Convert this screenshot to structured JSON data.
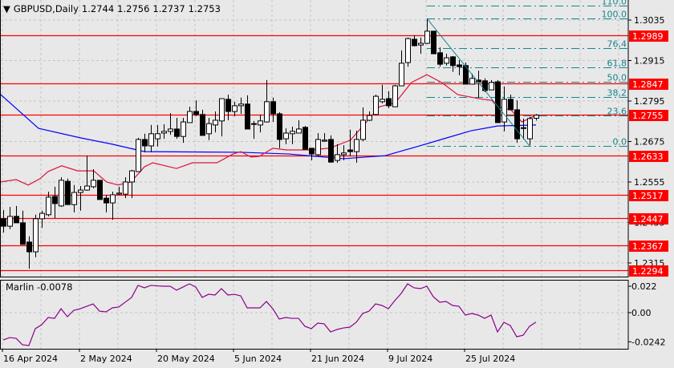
{
  "header": {
    "menu_icon": "triangle-down-icon",
    "symbol_timeframe": "GBPUSD,Daily",
    "open": "1.2744",
    "high": "1.2756",
    "low": "1.2737",
    "close": "1.2753"
  },
  "indicator": {
    "name": "Marlin",
    "value": "-0.0078"
  },
  "colors": {
    "background": "#e8e8e8",
    "level_lines": "#ff0000",
    "fibo": "#17868e",
    "ma_slow": "#0000ff",
    "ma_fast": "#dc143c",
    "marlin": "#8b008b",
    "grid": "#c4c4c4"
  },
  "chart_data": {
    "type": "candlestick",
    "title": "GBPUSD,Daily",
    "x_tick_labels": [
      {
        "bar": 0,
        "label": "16 Apr 2024"
      },
      {
        "bar": 12,
        "label": "2 May 2024"
      },
      {
        "bar": 24,
        "label": "20 May 2024"
      },
      {
        "bar": 36,
        "label": "5 Jun 2024"
      },
      {
        "bar": 48,
        "label": "21 Jun 2024"
      },
      {
        "bar": 60,
        "label": "9 Jul 2024"
      },
      {
        "bar": 72,
        "label": "25 Jul 2024"
      }
    ],
    "y_tick_labels": [
      "1.3035",
      "1.2915",
      "1.2795",
      "1.2675",
      "1.2555",
      "1.2435",
      "1.2315"
    ],
    "ylim": [
      1.2274,
      1.3115
    ],
    "grid": true,
    "candles_ohlc": [
      [
        1.2446,
        1.2472,
        1.2405,
        1.2424
      ],
      [
        1.2424,
        1.2481,
        1.2415,
        1.2453
      ],
      [
        1.2453,
        1.2484,
        1.2434,
        1.2434
      ],
      [
        1.2434,
        1.247,
        1.237,
        1.237
      ],
      [
        1.2377,
        1.2394,
        1.2298,
        1.2348
      ],
      [
        1.2348,
        1.2458,
        1.2332,
        1.2446
      ],
      [
        1.2446,
        1.247,
        1.2419,
        1.2462
      ],
      [
        1.2458,
        1.2526,
        1.2453,
        1.251
      ],
      [
        1.2512,
        1.2541,
        1.2448,
        1.2491
      ],
      [
        1.2484,
        1.2569,
        1.2481,
        1.256
      ],
      [
        1.2557,
        1.2565,
        1.2488,
        1.2488
      ],
      [
        1.2488,
        1.2546,
        1.2465,
        1.2524
      ],
      [
        1.2524,
        1.2543,
        1.247,
        1.2531
      ],
      [
        1.2531,
        1.2633,
        1.2529,
        1.2543
      ],
      [
        1.2541,
        1.2593,
        1.2536,
        1.256
      ],
      [
        1.256,
        1.256,
        1.2503,
        1.2503
      ],
      [
        1.2507,
        1.2517,
        1.2465,
        1.2493
      ],
      [
        1.2493,
        1.2526,
        1.2443,
        1.2517
      ],
      [
        1.2519,
        1.2541,
        1.2517,
        1.2522
      ],
      [
        1.2519,
        1.2569,
        1.2507,
        1.2555
      ],
      [
        1.2555,
        1.2591,
        1.2507,
        1.2588
      ],
      [
        1.2586,
        1.2686,
        1.2586,
        1.2681
      ],
      [
        1.2681,
        1.2698,
        1.2643,
        1.2662
      ],
      [
        1.2662,
        1.2724,
        1.2643,
        1.2698
      ],
      [
        1.2683,
        1.2724,
        1.266,
        1.2698
      ],
      [
        1.27,
        1.2726,
        1.2683,
        1.2705
      ],
      [
        1.2705,
        1.2759,
        1.2695,
        1.2712
      ],
      [
        1.2712,
        1.2745,
        1.2683,
        1.269
      ],
      [
        1.269,
        1.2745,
        1.2671,
        1.2733
      ],
      [
        1.2731,
        1.2778,
        1.2731,
        1.2764
      ],
      [
        1.2764,
        1.2797,
        1.275,
        1.2755
      ],
      [
        1.2755,
        1.2769,
        1.2693,
        1.2693
      ],
      [
        1.2698,
        1.2745,
        1.2679,
        1.2728
      ],
      [
        1.2724,
        1.2764,
        1.2702,
        1.2738
      ],
      [
        1.2736,
        1.2802,
        1.269,
        1.2802
      ],
      [
        1.28,
        1.2814,
        1.2738,
        1.2764
      ],
      [
        1.2764,
        1.2793,
        1.275,
        1.2781
      ],
      [
        1.2781,
        1.2805,
        1.2757,
        1.2786
      ],
      [
        1.2786,
        1.2812,
        1.2712,
        1.2712
      ],
      [
        1.2728,
        1.2736,
        1.2683,
        1.2726
      ],
      [
        1.2724,
        1.2755,
        1.2702,
        1.2736
      ],
      [
        1.2733,
        1.2857,
        1.2731,
        1.2793
      ],
      [
        1.2793,
        1.2805,
        1.2733,
        1.2757
      ],
      [
        1.2757,
        1.2762,
        1.2655,
        1.2681
      ],
      [
        1.2683,
        1.2714,
        1.2667,
        1.27
      ],
      [
        1.2698,
        1.2719,
        1.2667,
        1.2705
      ],
      [
        1.27,
        1.2738,
        1.27,
        1.2712
      ],
      [
        1.2717,
        1.2721,
        1.2652,
        1.2652
      ],
      [
        1.2655,
        1.2655,
        1.2619,
        1.2638
      ],
      [
        1.2636,
        1.27,
        1.2631,
        1.2681
      ],
      [
        1.2676,
        1.27,
        1.2674,
        1.2679
      ],
      [
        1.2681,
        1.2693,
        1.2612,
        1.2614
      ],
      [
        1.2619,
        1.2667,
        1.2612,
        1.2636
      ],
      [
        1.2636,
        1.2664,
        1.2619,
        1.2641
      ],
      [
        1.265,
        1.271,
        1.2631,
        1.2645
      ],
      [
        1.2645,
        1.2707,
        1.2612,
        1.2681
      ],
      [
        1.2681,
        1.2776,
        1.2676,
        1.2738
      ],
      [
        1.2738,
        1.2764,
        1.2736,
        1.2752
      ],
      [
        1.2755,
        1.2814,
        1.2752,
        1.2809
      ],
      [
        1.2793,
        1.2843,
        1.2788,
        1.28
      ],
      [
        1.2802,
        1.2824,
        1.2774,
        1.2781
      ],
      [
        1.2778,
        1.2843,
        1.2778,
        1.284
      ],
      [
        1.284,
        1.2945,
        1.284,
        1.2907
      ],
      [
        1.2909,
        1.2983,
        1.2897,
        1.298
      ],
      [
        1.2978,
        1.299,
        1.2957,
        1.2959
      ],
      [
        1.2961,
        1.2983,
        1.2935,
        1.2966
      ],
      [
        1.2966,
        1.304,
        1.2964,
        1.3002
      ],
      [
        1.3002,
        1.3002,
        1.2935,
        1.2935
      ],
      [
        1.2938,
        1.2954,
        1.2897,
        1.2904
      ],
      [
        1.2907,
        1.2935,
        1.29,
        1.2923
      ],
      [
        1.2926,
        1.2928,
        1.2881,
        1.29
      ],
      [
        1.2902,
        1.2916,
        1.2871,
        1.2897
      ],
      [
        1.29,
        1.2909,
        1.2845,
        1.2845
      ],
      [
        1.2845,
        1.2876,
        1.2845,
        1.2862
      ],
      [
        1.2857,
        1.2885,
        1.2805,
        1.2852
      ],
      [
        1.2855,
        1.2862,
        1.2821,
        1.2826
      ],
      [
        1.2828,
        1.2857,
        1.2828,
        1.285
      ],
      [
        1.2852,
        1.2857,
        1.2731,
        1.2731
      ],
      [
        1.2733,
        1.2838,
        1.2705,
        1.28
      ],
      [
        1.28,
        1.2814,
        1.2769,
        1.2769
      ],
      [
        1.2769,
        1.2797,
        1.2671,
        1.2683
      ],
      [
        1.2714,
        1.2743,
        1.2681,
        1.2716
      ],
      [
        1.2683,
        1.2748,
        1.2664,
        1.2743
      ],
      [
        1.2744,
        1.2756,
        1.2737,
        1.2753
      ]
    ],
    "ma_slow": [
      [
        -0.5,
        1.2816
      ],
      [
        5.5,
        1.2714
      ],
      [
        12,
        1.2686
      ],
      [
        17,
        1.2667
      ],
      [
        22,
        1.2645
      ],
      [
        37,
        1.2643
      ],
      [
        44.5,
        1.2638
      ],
      [
        53,
        1.2624
      ],
      [
        59.5,
        1.2633
      ],
      [
        64.5,
        1.266
      ],
      [
        68.6,
        1.2683
      ],
      [
        72.9,
        1.2707
      ],
      [
        77,
        1.2721
      ],
      [
        83,
        1.2724
      ]
    ],
    "ma_fast": [
      [
        -0.5,
        1.2555
      ],
      [
        2,
        1.2562
      ],
      [
        3.9,
        1.2546
      ],
      [
        5.75,
        1.2565
      ],
      [
        7,
        1.2586
      ],
      [
        9.1,
        1.2603
      ],
      [
        11.6,
        1.2588
      ],
      [
        14.1,
        1.2588
      ],
      [
        16.1,
        1.2555
      ],
      [
        17.9,
        1.2546
      ],
      [
        19.9,
        1.2555
      ],
      [
        22,
        1.26
      ],
      [
        23.3,
        1.2612
      ],
      [
        27,
        1.2595
      ],
      [
        29.5,
        1.2612
      ],
      [
        33.3,
        1.2612
      ],
      [
        35.8,
        1.2638
      ],
      [
        37,
        1.2645
      ],
      [
        38.6,
        1.2629
      ],
      [
        39.9,
        1.2631
      ],
      [
        42,
        1.2655
      ],
      [
        44.1,
        1.265
      ],
      [
        47.9,
        1.265
      ],
      [
        50.8,
        1.2655
      ],
      [
        54.1,
        1.2679
      ],
      [
        56.6,
        1.2733
      ],
      [
        58.6,
        1.2778
      ],
      [
        61.1,
        1.279
      ],
      [
        63.6,
        1.285
      ],
      [
        66,
        1.2873
      ],
      [
        68.3,
        1.285
      ],
      [
        70.8,
        1.2814
      ],
      [
        74.1,
        1.2802
      ],
      [
        76.1,
        1.2797
      ],
      [
        77,
        1.2778
      ],
      [
        79.1,
        1.2769
      ],
      [
        80.8,
        1.2733
      ],
      [
        82.9,
        1.2752
      ]
    ],
    "horizontal_levels": [
      "1.2989",
      "1.2847",
      "1.2755",
      "1.2633",
      "1.2517",
      "1.2447",
      "1.2367",
      "1.2294"
    ],
    "fibonacci": {
      "from_bar": 66,
      "high": 1.304,
      "low": 1.2662,
      "trend_to_bar": 82,
      "levels": [
        {
          "ratio": 1.1,
          "label": "110.0"
        },
        {
          "ratio": 1.0,
          "label": "100.0"
        },
        {
          "ratio": 0.764,
          "label": "76,4"
        },
        {
          "ratio": 0.618,
          "label": "61,8"
        },
        {
          "ratio": 0.5,
          "label": "50,0"
        },
        {
          "ratio": 0.382,
          "label": "38,2"
        },
        {
          "ratio": 0.236,
          "label": "23,6"
        },
        {
          "ratio": 0.0,
          "label": "0.0"
        }
      ]
    },
    "marlin": {
      "y_tick_labels": [
        {
          "v": 0.022,
          "label": "0.022"
        },
        {
          "v": 0.0,
          "label": "0.00"
        },
        {
          "v": -0.0242,
          "label": "-0.0242"
        }
      ],
      "values": [
        -0.0227,
        -0.0207,
        -0.0213,
        -0.0267,
        -0.0273,
        -0.0133,
        -0.01,
        -0.004,
        -0.0047,
        0.0033,
        -0.0033,
        0.002,
        0.0033,
        0.0053,
        0.0073,
        0.0013,
        0.0007,
        0.004,
        0.0047,
        0.0087,
        0.0127,
        0.0227,
        0.0207,
        0.0227,
        0.0223,
        0.022,
        0.022,
        0.0187,
        0.0213,
        0.024,
        0.0213,
        0.0127,
        0.0153,
        0.0147,
        0.02,
        0.0147,
        0.0153,
        0.014,
        0.004,
        0.004,
        0.004,
        0.0093,
        0.0033,
        -0.0053,
        -0.004,
        -0.0047,
        -0.0047,
        -0.0113,
        -0.0133,
        -0.0087,
        -0.0093,
        -0.016,
        -0.014,
        -0.0127,
        -0.012,
        -0.008,
        -0.0007,
        0.0013,
        0.0073,
        0.006,
        0.0033,
        0.01,
        0.016,
        0.024,
        0.0207,
        0.02,
        0.022,
        0.0133,
        0.0087,
        0.0093,
        0.006,
        0.0053,
        -0.002,
        -0.0007,
        -0.002,
        -0.0047,
        -0.002,
        -0.016,
        -0.008,
        -0.0107,
        -0.02,
        -0.0187,
        -0.0113,
        -0.0078
      ]
    }
  }
}
